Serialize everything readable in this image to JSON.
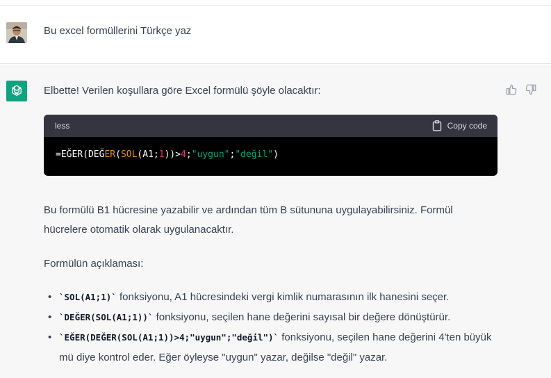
{
  "user_message": {
    "text": "Bu excel formüllerini Türkçe yaz",
    "avatar_icon": "user-photo-avatar"
  },
  "assistant_message": {
    "avatar_icon": "openai-logo-icon",
    "intro": "Elbette! Verilen koşullara göre Excel formülü şöyle olacaktır:",
    "code_block": {
      "language": "less",
      "copy_label": "Copy code",
      "code_parts": {
        "p0": "=EĞER(DEĞ",
        "p1": "ER",
        "p2": "(",
        "p3": "SOL",
        "p4": "(A1;",
        "p5": "1",
        "p6": "))>",
        "p7": "4",
        "p8": ";",
        "p9": "\"uygun\"",
        "p10": ";",
        "p11": "\"değil\"",
        "p12": ")"
      },
      "colors": {
        "ident": "#e9950c",
        "number": "#df3079",
        "string": "#00a67d"
      }
    },
    "paragraph_1": "Bu formülü B1 hücresine yazabilir ve ardından tüm B sütununa uygulayabilirsiniz. Formül hücrelere otomatik olarak uygulanacaktır.",
    "paragraph_2": "Formülün açıklaması:",
    "bullets": [
      {
        "code": "`SOL(A1;1)`",
        "text": " fonksiyonu, A1 hücresindeki vergi kimlik numarasının ilk hanesini seçer."
      },
      {
        "code": "`DEĞER(SOL(A1;1))`",
        "text": " fonksiyonu, seçilen hane değerini sayısal bir değere dönüştürür."
      },
      {
        "code": "`EĞER(DEĞER(SOL(A1;1))>4;\"uygun\";\"değil\")`",
        "text": " fonksiyonu, seçilen hane değerini 4'ten büyük mü diye kontrol eder. Eğer öyleyse \"uygun\" yazar, değilse \"değil\" yazar."
      }
    ]
  },
  "feedback": {
    "thumbs_up_icon": "thumbs-up-icon",
    "thumbs_down_icon": "thumbs-down-icon"
  },
  "colors": {
    "brand": "#10a37f",
    "assistant_bg": "#f7f7f8",
    "code_header_bg": "#343541"
  }
}
